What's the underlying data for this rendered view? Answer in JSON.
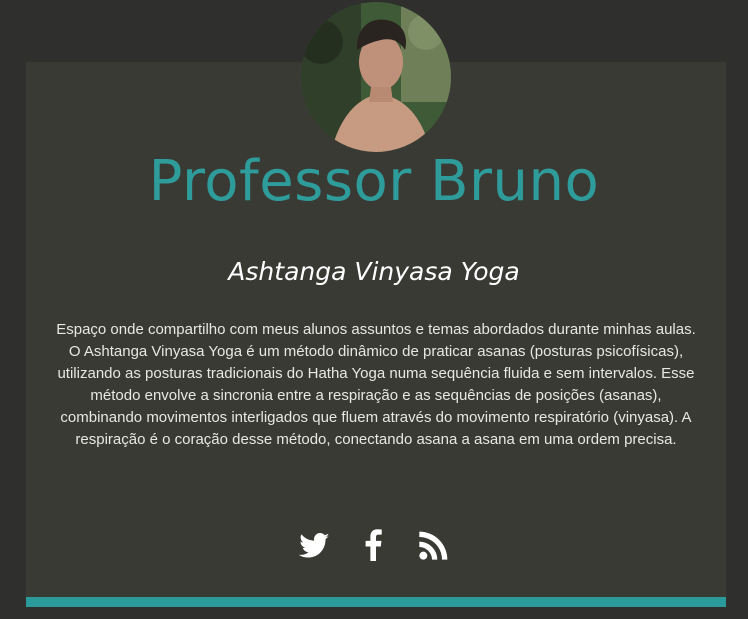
{
  "profile": {
    "name": "Professor Bruno",
    "subtitle": "Ashtanga Vinyasa Yoga",
    "description": "Espaço onde compartilho com meus alunos assuntos e temas abordados durante minhas aulas. O Ashtanga Vinyasa Yoga é um método dinâmico de praticar asanas (posturas psicofísicas), utilizando as posturas tradicionais do Hatha Yoga numa sequência fluida e sem intervalos. Esse método envolve a sincronia entre a respiração e as sequências de posições (asanas), combinando movimentos interligados que fluem através do movimento respiratório (vinyasa). A respiração é o coração desse método, conectando asana a asana em uma ordem precisa."
  },
  "social": {
    "icons": [
      "twitter-icon",
      "facebook-icon",
      "rss-icon"
    ]
  },
  "colors": {
    "accent": "#2e9c9b",
    "card_background": "#3a3a35",
    "page_background": "#2f2f2d"
  }
}
